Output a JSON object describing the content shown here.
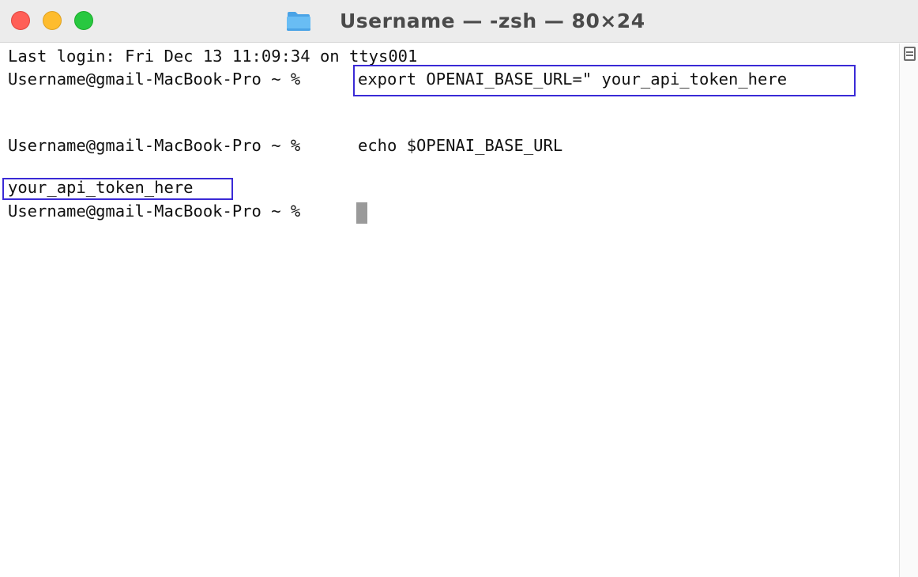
{
  "window": {
    "title": "Username",
    "subtitle": " — -zsh — 80×24"
  },
  "terminal": {
    "last_login": "Last login: Fri Dec 13 11:09:34 on ttys001",
    "prompt": "Username@gmail-MacBook-Pro ~ % ",
    "command_1": "export OPENAI_BASE_URL=\" your_api_token_here",
    "command_2": "echo $OPENAI_BASE_URL",
    "output_1": "your_api_token_here"
  },
  "colors": {
    "highlight_border": "#3a2ad6",
    "cursor": "#9a9a9a",
    "close": "#ff5f57",
    "minimize": "#febc2e",
    "zoom": "#28c840"
  },
  "icons": {
    "title_icon": "folder-icon",
    "scrollbar_icon": "split-pane-icon"
  }
}
